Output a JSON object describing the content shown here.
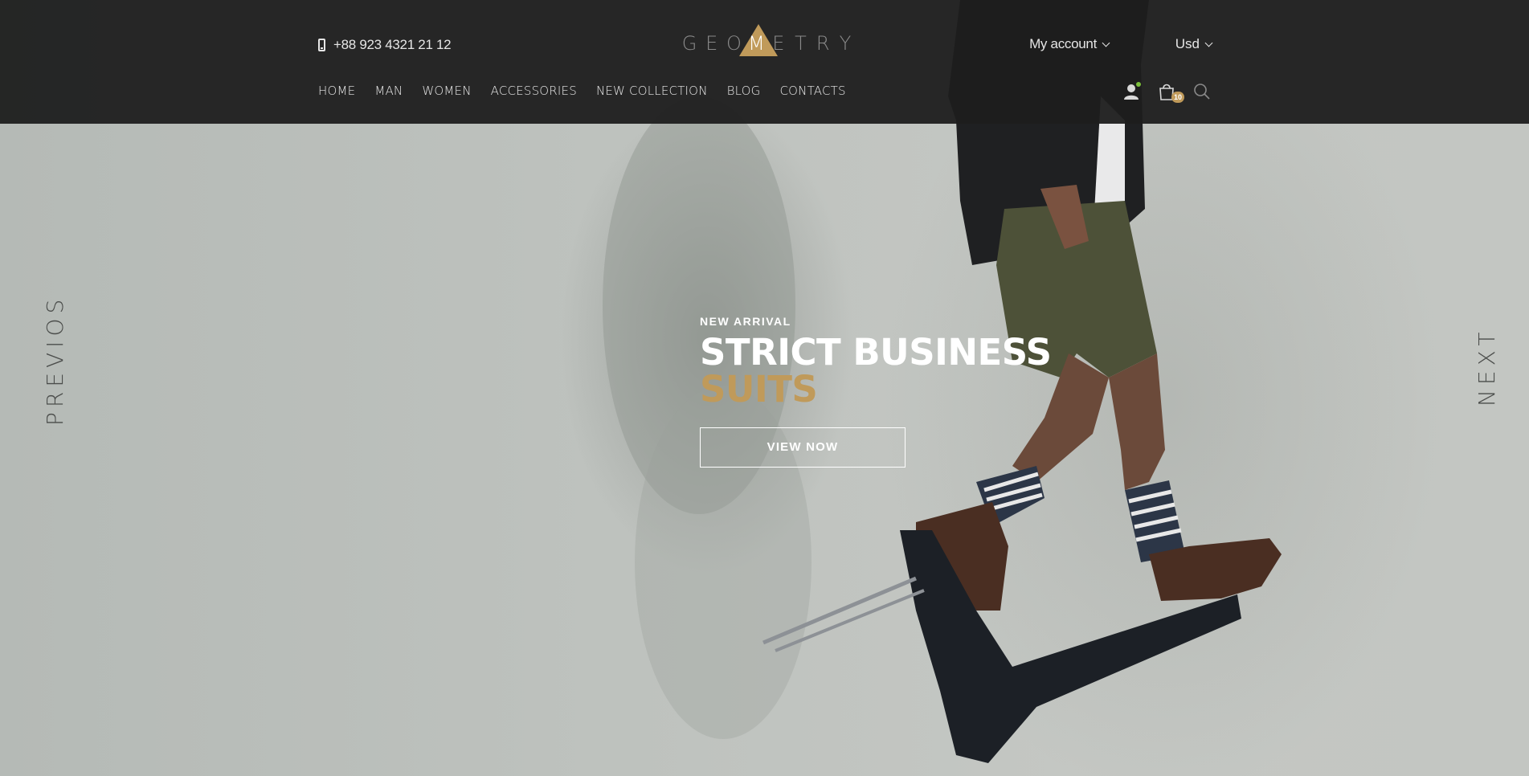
{
  "header": {
    "phone": "+88 923 4321 21 12",
    "logo_letters": [
      "G",
      "E",
      "O",
      "M",
      "E",
      "T",
      "R",
      "Y"
    ],
    "account_label": "My account",
    "currency_label": "Usd",
    "cart_count": "10"
  },
  "nav": {
    "items": [
      "HOME",
      "MAN",
      "WOMEN",
      "ACCESSORIES",
      "NEW COLLECTION",
      "BLOG",
      "CONTACTS"
    ]
  },
  "slide": {
    "kicker": "NEW ARRIVAL",
    "title_line1": "STRICT BUSINESS",
    "title_line2": "SUITS",
    "cta_label": "VIEW NOW"
  },
  "slider": {
    "prev_label": "PREVIOS",
    "next_label": "NEXT"
  },
  "colors": {
    "accent": "#c09a5a",
    "header_bg": "#1e1e1e",
    "online_dot": "#7bbf3a"
  },
  "icons": [
    "phone-icon",
    "chevron-down-icon",
    "user-icon",
    "cart-icon",
    "search-icon"
  ]
}
